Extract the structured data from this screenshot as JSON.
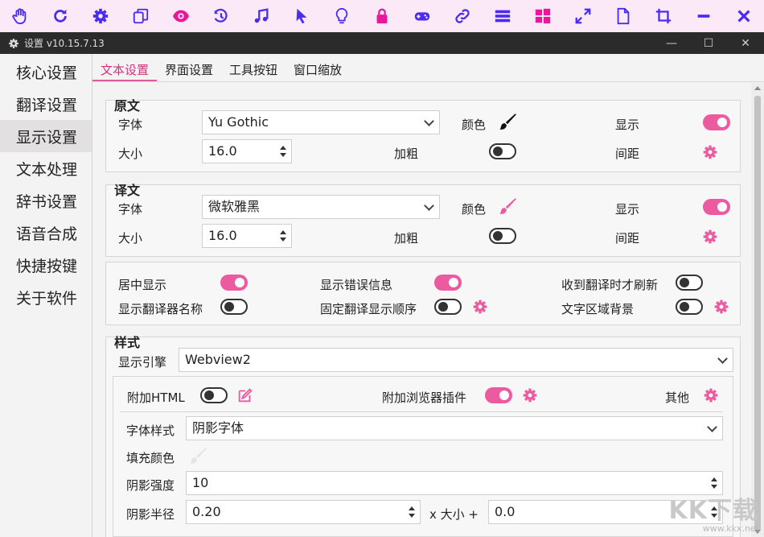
{
  "toolbar": {
    "icons": [
      "hand-icon",
      "refresh-icon",
      "gear-icon",
      "copy-icon",
      "eye-icon",
      "history-icon",
      "music-icon",
      "cursor-icon",
      "bulb-icon",
      "lock-icon",
      "gamepad-icon",
      "link-icon",
      "list-icon",
      "windows-icon",
      "expand-icon",
      "file-icon",
      "crop-icon",
      "minimize-icon",
      "close-icon"
    ],
    "accent": "#4a2cf0",
    "active_color": "#e8189a"
  },
  "window": {
    "title": "设置 v10.15.7.13",
    "minimize": "—",
    "maximize": "☐",
    "close": "✕"
  },
  "sidebar": {
    "items": [
      {
        "label": "核心设置"
      },
      {
        "label": "翻译设置"
      },
      {
        "label": "显示设置"
      },
      {
        "label": "文本处理"
      },
      {
        "label": "辞书设置"
      },
      {
        "label": "语音合成"
      },
      {
        "label": "快捷按键"
      },
      {
        "label": "关于软件"
      }
    ],
    "active_index": 2
  },
  "tabs": [
    {
      "label": "文本设置"
    },
    {
      "label": "界面设置"
    },
    {
      "label": "工具按钮"
    },
    {
      "label": "窗口缩放"
    }
  ],
  "original": {
    "title": "原文",
    "font_label": "字体",
    "font_value": "Yu Gothic",
    "color_label": "颜色",
    "show_label": "显示",
    "size_label": "大小",
    "size_value": "16.0",
    "bold_label": "加粗",
    "spacing_label": "间距",
    "brush_color": "#111111",
    "show_on": true,
    "bold_on": false
  },
  "translation": {
    "title": "译文",
    "font_label": "字体",
    "font_value": "微软雅黑",
    "color_label": "颜色",
    "show_label": "显示",
    "size_label": "大小",
    "size_value": "16.0",
    "bold_label": "加粗",
    "spacing_label": "间距",
    "brush_color": "#ec5a9f",
    "show_on": true,
    "bold_on": false
  },
  "options": {
    "center_display": "居中显示",
    "show_error": "显示错误信息",
    "refresh_on_receive": "收到翻译时才刷新",
    "show_translator_name": "显示翻译器名称",
    "fixed_order": "固定翻译显示顺序",
    "text_area_bg": "文字区域背景",
    "center_on": true,
    "error_on": true,
    "refresh_on": false,
    "name_on": false,
    "order_on": false,
    "bg_on": false
  },
  "style": {
    "title": "样式",
    "engine_label": "显示引擎",
    "engine_value": "Webview2",
    "extra_html_label": "附加HTML",
    "extra_html_on": false,
    "browser_plugin_label": "附加浏览器插件",
    "browser_plugin_on": true,
    "other_label": "其他",
    "font_style_label": "字体样式",
    "font_style_value": "阴影字体",
    "fill_color_label": "填充颜色",
    "shadow_strength_label": "阴影强度",
    "shadow_strength_value": "10",
    "shadow_radius_label": "阴影半径",
    "shadow_radius_value": "0.20",
    "x_size_label": "x 大小 +",
    "x_size_value": "0.0"
  },
  "watermark": {
    "logo": "KK下载",
    "url": "www.kkx.net"
  }
}
